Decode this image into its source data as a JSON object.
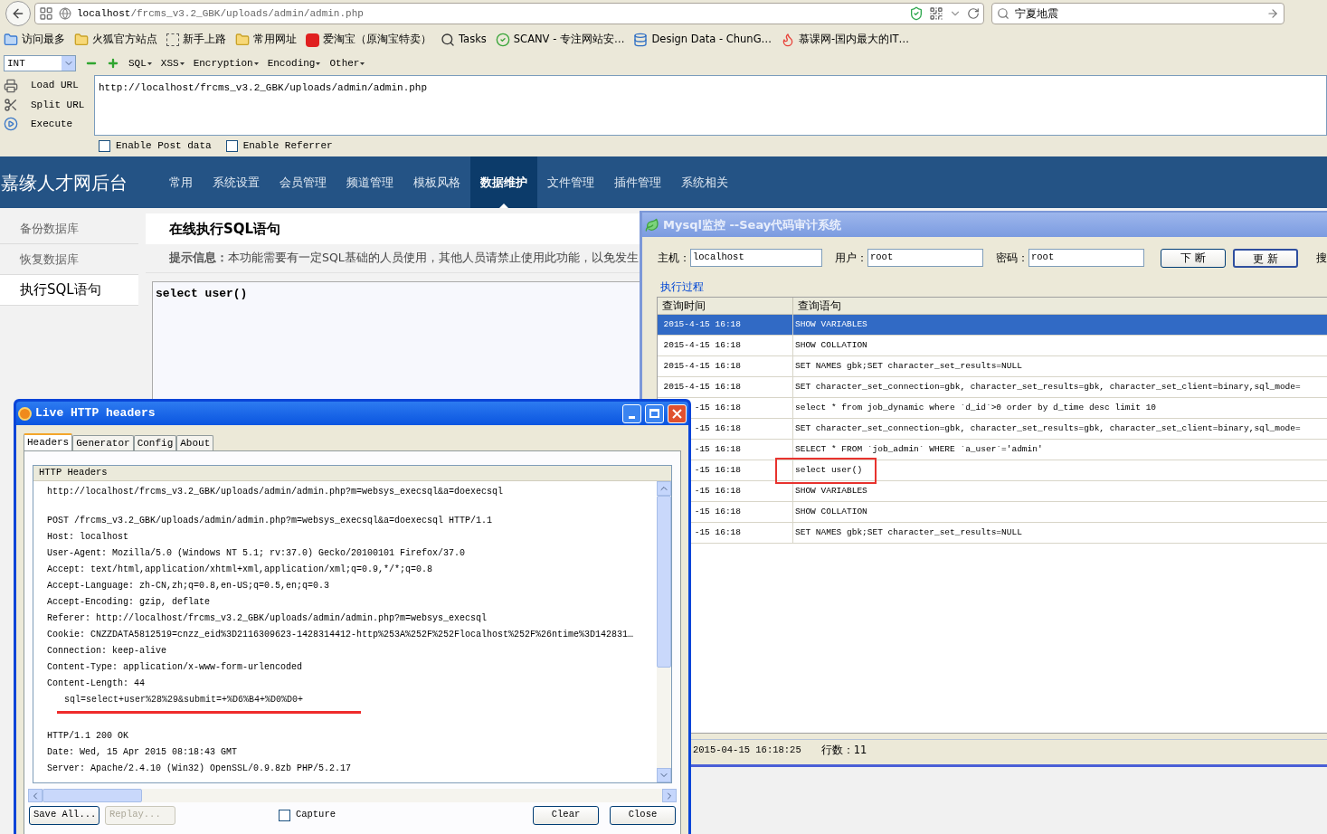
{
  "browser": {
    "url_host": "localhost",
    "url_path": "/frcms_v3.2_GBK/uploads/admin/admin.php",
    "search": "宁夏地震"
  },
  "bookmarks": [
    {
      "label": "访问最多",
      "kind": "smart"
    },
    {
      "label": "火狐官方站点",
      "kind": "folder"
    },
    {
      "label": "新手上路",
      "kind": "dashed"
    },
    {
      "label": "常用网址",
      "kind": "folder"
    },
    {
      "label": "爱淘宝（原淘宝特卖）",
      "kind": "taobao"
    },
    {
      "label": "Tasks",
      "kind": "magnifier"
    },
    {
      "label": "SCANV - 专注网站安…",
      "kind": "check"
    },
    {
      "label": "Design Data - ChunG…",
      "kind": "database"
    },
    {
      "label": "慕课网-国内最大的IT…",
      "kind": "flame"
    }
  ],
  "hackbar": {
    "type_select": "INT",
    "menus": [
      "SQL",
      "XSS",
      "Encryption",
      "Encoding",
      "Other"
    ],
    "actions": [
      {
        "label": "Load URL",
        "kind": "load"
      },
      {
        "label": "Split URL",
        "kind": "split"
      },
      {
        "label": "Execute",
        "kind": "execute"
      }
    ],
    "url_value": "http://localhost/frcms_v3.2_GBK/uploads/admin/admin.php",
    "options": [
      {
        "label": "Enable Post data",
        "checked": false
      },
      {
        "label": "Enable Referrer",
        "checked": false
      }
    ]
  },
  "admin": {
    "brand": "嘉缘人才网后台",
    "nav": [
      {
        "label": "常用",
        "selected": false
      },
      {
        "label": "系统设置",
        "selected": false
      },
      {
        "label": "会员管理",
        "selected": false
      },
      {
        "label": "频道管理",
        "selected": false
      },
      {
        "label": "模板风格",
        "selected": false
      },
      {
        "label": "数据维护",
        "selected": true
      },
      {
        "label": "文件管理",
        "selected": false
      },
      {
        "label": "插件管理",
        "selected": false
      },
      {
        "label": "系统相关",
        "selected": false
      }
    ],
    "sidebar": [
      {
        "label": "备份数据库",
        "selected": false
      },
      {
        "label": "恢复数据库",
        "selected": false
      },
      {
        "label": "执行SQL语句",
        "selected": true
      }
    ],
    "page_title": "在线执行SQL语句",
    "hint_label": "提示信息：",
    "hint_text": "本功能需要有一定SQL基础的人员使用，其他人员请禁止使用此功能，以免发生",
    "sql_value": "select user()"
  },
  "mysql_monitor": {
    "title": "Mysql监控 --Seay代码审计系统",
    "fields": [
      {
        "label": "主机：",
        "value": "localhost"
      },
      {
        "label": "用户：",
        "value": "root"
      },
      {
        "label": "密码：",
        "value": "root"
      }
    ],
    "buttons": [
      "下 断",
      "更 新"
    ],
    "search_label": "搜",
    "group_label": "执行过程",
    "columns": [
      "查询时间",
      "查询语句"
    ],
    "rows": [
      {
        "time": "2015-4-15 16:18",
        "query": "SHOW VARIABLES",
        "selected": true,
        "highlighted": false
      },
      {
        "time": "2015-4-15 16:18",
        "query": "SHOW COLLATION",
        "selected": false,
        "highlighted": false
      },
      {
        "time": "2015-4-15 16:18",
        "query": "SET NAMES gbk;SET character_set_results=NULL",
        "selected": false,
        "highlighted": false
      },
      {
        "time": "2015-4-15 16:18",
        "query": "SET character_set_connection=gbk, character_set_results=gbk, character_set_client=binary,sql_mode=",
        "selected": false,
        "highlighted": false
      },
      {
        "time": "-15 16:18",
        "query": "select * from job_dynamic where `d_id`>0 order by d_time desc limit 10",
        "selected": false,
        "highlighted": false
      },
      {
        "time": "-15 16:18",
        "query": "SET character_set_connection=gbk, character_set_results=gbk, character_set_client=binary,sql_mode=",
        "selected": false,
        "highlighted": false
      },
      {
        "time": "-15 16:18",
        "query": "SELECT * FROM `job_admin` WHERE `a_user`='admin'",
        "selected": false,
        "highlighted": false
      },
      {
        "time": "-15 16:18",
        "query": "select user()",
        "selected": false,
        "highlighted": true
      },
      {
        "time": "-15 16:18",
        "query": "SHOW VARIABLES",
        "selected": false,
        "highlighted": false
      },
      {
        "time": "-15 16:18",
        "query": "SHOW COLLATION",
        "selected": false,
        "highlighted": false
      },
      {
        "time": "-15 16:18",
        "query": "SET NAMES gbk;SET character_set_results=NULL",
        "selected": false,
        "highlighted": false
      }
    ],
    "status_time": "2015-04-15 16:18:25",
    "status_rows": "行数：11"
  },
  "http_headers": {
    "title": "Live HTTP headers",
    "tabs": [
      {
        "label": "Headers",
        "selected": true
      },
      {
        "label": "Generator",
        "selected": false
      },
      {
        "label": "Config",
        "selected": false
      },
      {
        "label": "About",
        "selected": false
      }
    ],
    "list_header": "HTTP Headers",
    "blocks": [
      {
        "lines": [
          {
            "text": "http://localhost/frcms_v3.2_GBK/uploads/admin/admin.php?m=websys_execsql&a=doexecsql",
            "kind": "header",
            "underlined": false
          }
        ]
      },
      {
        "lines": [
          {
            "text": "POST /frcms_v3.2_GBK/uploads/admin/admin.php?m=websys_execsql&a=doexecsql HTTP/1.1",
            "kind": "header",
            "underlined": false
          },
          {
            "text": "Host: localhost",
            "kind": "header",
            "underlined": false
          },
          {
            "text": "User-Agent: Mozilla/5.0 (Windows NT 5.1; rv:37.0) Gecko/20100101 Firefox/37.0",
            "kind": "header",
            "underlined": false
          },
          {
            "text": "Accept: text/html,application/xhtml+xml,application/xml;q=0.9,*/*;q=0.8",
            "kind": "header",
            "underlined": false
          },
          {
            "text": "Accept-Language: zh-CN,zh;q=0.8,en-US;q=0.5,en;q=0.3",
            "kind": "header",
            "underlined": false
          },
          {
            "text": "Accept-Encoding: gzip, deflate",
            "kind": "header",
            "underlined": false
          },
          {
            "text": "Referer: http://localhost/frcms_v3.2_GBK/uploads/admin/admin.php?m=websys_execsql",
            "kind": "header",
            "underlined": false
          },
          {
            "text": "Cookie: CNZZDATA5812519=cnzz_eid%3D2116309623-1428314412-http%253A%252F%252Flocalhost%252F%26ntime%3D142831…",
            "kind": "header",
            "underlined": false
          },
          {
            "text": "Connection: keep-alive",
            "kind": "header",
            "underlined": false
          },
          {
            "text": "Content-Type: application/x-www-form-urlencoded",
            "kind": "header",
            "underlined": false
          },
          {
            "text": "Content-Length: 44",
            "kind": "header",
            "underlined": false
          },
          {
            "text": "sql=select+user%28%29&submit=+%D6%B4+%D0%D0+",
            "kind": "body",
            "underlined": true
          }
        ]
      },
      {
        "lines": [
          {
            "text": "HTTP/1.1 200 OK",
            "kind": "header",
            "underlined": false
          },
          {
            "text": "Date: Wed, 15 Apr 2015 08:18:43 GMT",
            "kind": "header",
            "underlined": false
          },
          {
            "text": "Server: Apache/2.4.10 (Win32) OpenSSL/0.9.8zb PHP/5.2.17",
            "kind": "header",
            "underlined": false
          }
        ]
      }
    ],
    "left_buttons": [
      {
        "label": "Save All...",
        "disabled": false
      },
      {
        "label": "Replay...",
        "disabled": true
      }
    ],
    "capture": {
      "label": "Capture",
      "checked": false
    },
    "right_buttons": [
      {
        "label": "Clear",
        "disabled": false
      },
      {
        "label": "Close",
        "disabled": false
      }
    ]
  }
}
